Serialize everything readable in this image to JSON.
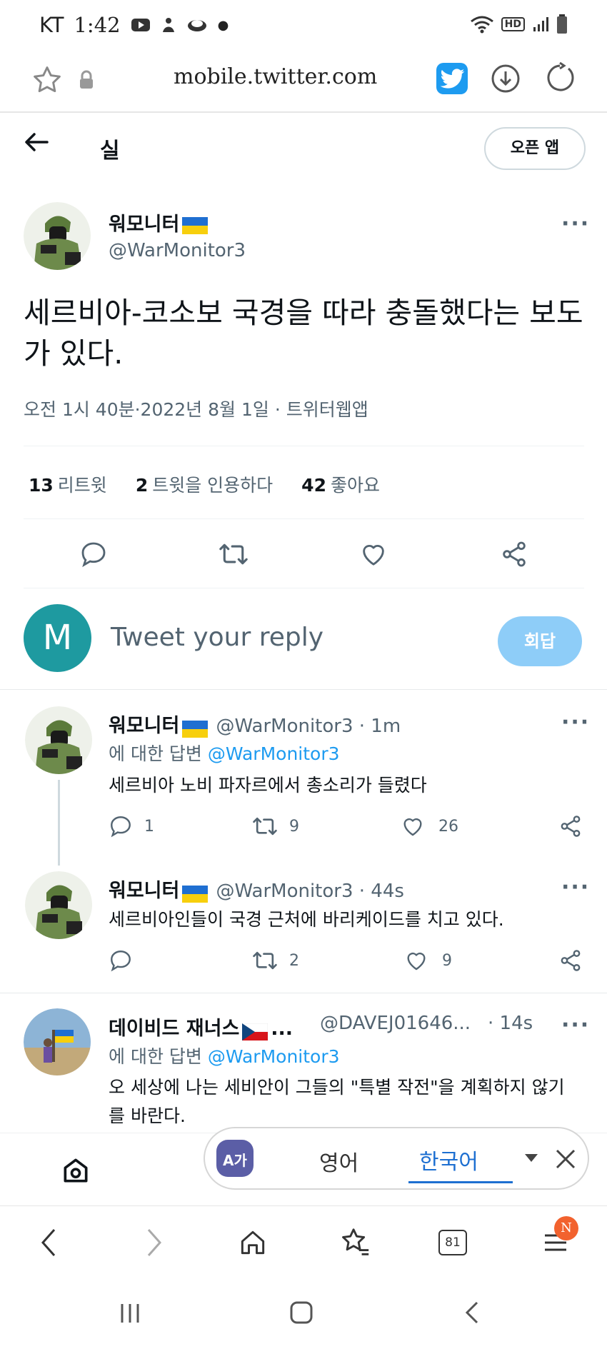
{
  "status_bar": {
    "carrier": "KT",
    "time": "1:42",
    "hd": "HD"
  },
  "browser": {
    "url": "mobile.twitter.com"
  },
  "header": {
    "title": "실",
    "open_app": "오픈 앱"
  },
  "main_tweet": {
    "name": "워모니터",
    "handle": "@WarMonitor3",
    "text": "세르비아-코소보 국경을 따라 충돌했다는 보도가 있다.",
    "meta": "오전 1시 40분·2022년 8월 1일 · 트위터웹앱",
    "stats": {
      "retweets": "13",
      "retweets_label": "리트윗",
      "quotes": "2",
      "quotes_label": "트윗을 인용하다",
      "likes": "42",
      "likes_label": "좋아요"
    }
  },
  "reply_box": {
    "avatar_letter": "M",
    "placeholder": "Tweet your reply",
    "button": "회답"
  },
  "replies": [
    {
      "name": "워모니터",
      "handle_time": "@WarMonitor3 · 1m",
      "reply_to_prefix": "에 대한 답변",
      "reply_to": "@WarMonitor3",
      "text": "세르비아 노비 파자르에서 총소리가 들렸다",
      "replies": "1",
      "retweets": "9",
      "likes": "26"
    },
    {
      "name": "워모니터",
      "handle_time": "@WarMonitor3 · 44s",
      "text": "세르비아인들이 국경 근처에 바리케이드를 치고 있다.",
      "replies": "",
      "retweets": "2",
      "likes": "9"
    },
    {
      "name": "데이비드 재너스",
      "name_suffix": "...",
      "handle": "@DAVEJ01646...",
      "time": "· 14s",
      "reply_to_prefix": "에 대한 답변",
      "reply_to": "@WarMonitor3",
      "text": "오 세상에 나는 세비안이 그들의 \"특별 작전\"을 계획하지 않기를 바란다."
    }
  ],
  "translate_bar": {
    "icon_text": "A가",
    "from": "영어",
    "to": "한국어"
  },
  "bottom_nav": {
    "tabs_count": "81",
    "badge": "N"
  },
  "colors": {
    "twitter_blue": "#1d9bf0",
    "reply_button": "#8ecdf8",
    "avatar_m": "#1e9aa0"
  }
}
